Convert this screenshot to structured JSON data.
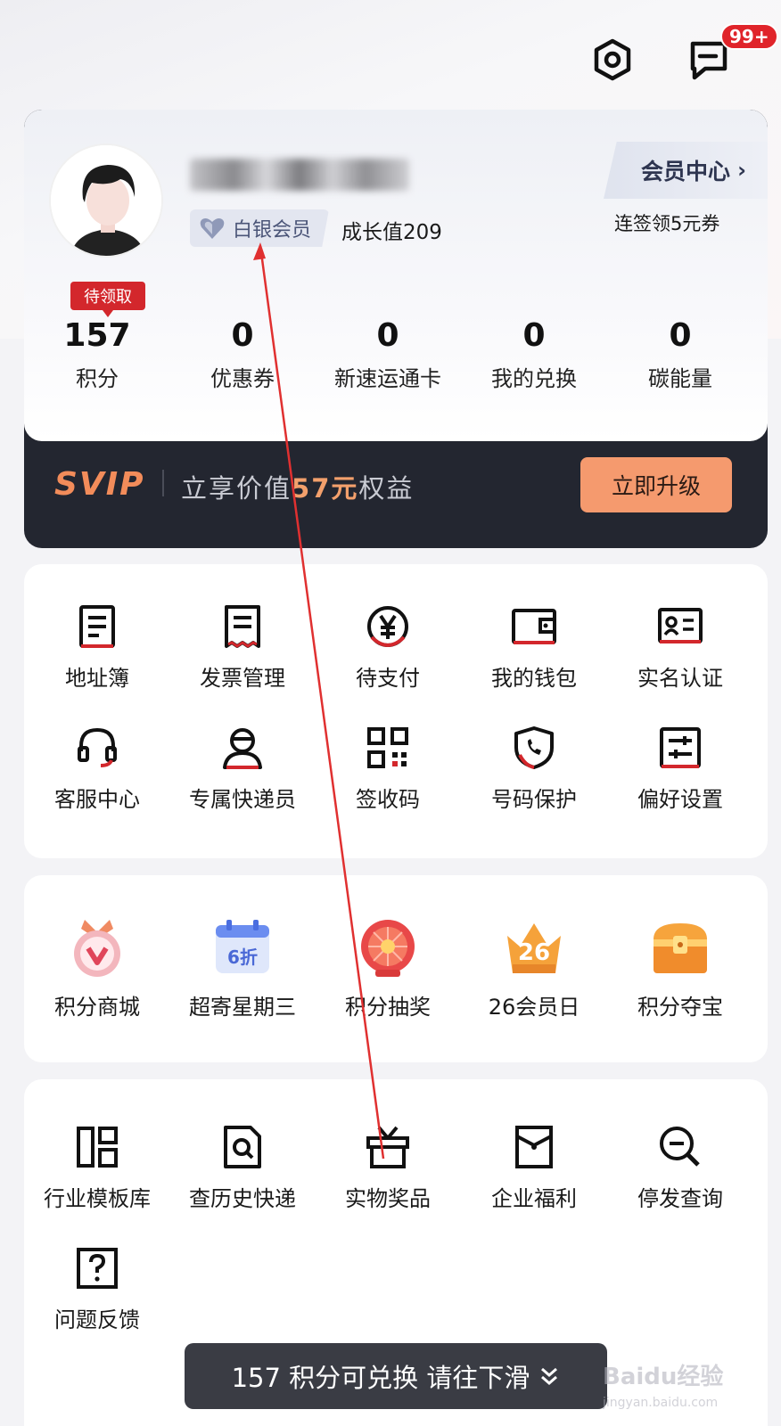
{
  "header": {
    "settings_icon": "settings-hexagon-icon",
    "message_icon": "message-icon",
    "message_badge": "99+"
  },
  "profile": {
    "level": "白银会员",
    "growth": "成长值209",
    "member_center": "会员中心",
    "sign_promo": "连签领5元券",
    "pending_tag": "待领取"
  },
  "stats": [
    {
      "value": "157",
      "label": "积分"
    },
    {
      "value": "0",
      "label": "优惠券"
    },
    {
      "value": "0",
      "label": "新速运通卡"
    },
    {
      "value": "0",
      "label": "我的兑换"
    },
    {
      "value": "0",
      "label": "碳能量"
    }
  ],
  "svip": {
    "logo": "SVIP",
    "text_prefix": "立享价值",
    "amount": "57元",
    "text_suffix": "权益",
    "button": "立即升级"
  },
  "services": [
    {
      "label": "地址簿",
      "icon": "address-book-icon"
    },
    {
      "label": "发票管理",
      "icon": "invoice-icon"
    },
    {
      "label": "待支付",
      "icon": "yen-icon"
    },
    {
      "label": "我的钱包",
      "icon": "wallet-icon"
    },
    {
      "label": "实名认证",
      "icon": "id-card-icon"
    },
    {
      "label": "客服中心",
      "icon": "headset-icon"
    },
    {
      "label": "专属快递员",
      "icon": "courier-icon"
    },
    {
      "label": "签收码",
      "icon": "qr-code-icon"
    },
    {
      "label": "号码保护",
      "icon": "phone-shield-icon"
    },
    {
      "label": "偏好设置",
      "icon": "sliders-icon"
    }
  ],
  "points": [
    {
      "label": "积分商城",
      "icon": "points-mall-medal-icon"
    },
    {
      "label": "超寄星期三",
      "icon": "calendar-discount-icon",
      "badge": "6折"
    },
    {
      "label": "积分抽奖",
      "icon": "lottery-wheel-icon"
    },
    {
      "label": "26会员日",
      "icon": "crown-26-icon",
      "badge": "26"
    },
    {
      "label": "积分夺宝",
      "icon": "treasure-chest-icon"
    }
  ],
  "tools": [
    {
      "label": "行业模板库",
      "icon": "template-library-icon"
    },
    {
      "label": "查历史快递",
      "icon": "history-search-icon"
    },
    {
      "label": "实物奖品",
      "icon": "gift-box-icon"
    },
    {
      "label": "企业福利",
      "icon": "enterprise-envelope-icon"
    },
    {
      "label": "停发查询",
      "icon": "zoom-out-search-icon"
    },
    {
      "label": "问题反馈",
      "icon": "question-box-icon"
    }
  ],
  "bottom_bar": {
    "text": "157 积分可兑换 请往下滑",
    "icon": "double-chevron-down-icon"
  },
  "watermark": {
    "main": "Baidu经验",
    "sub": "jingyan.baidu.com"
  }
}
